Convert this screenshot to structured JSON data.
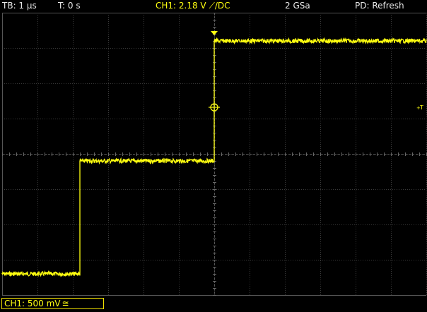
{
  "status_bar": {
    "timebase": "TB: 1 μs",
    "trigger_time": "T: 0 s",
    "channel_setting": "CH1: 2.18 V ⟋/DC",
    "sample_rate": "2 GSa",
    "display_mode": "PD: Refresh"
  },
  "channel_badge": {
    "label": "CH1: 500 mV",
    "coupling_symbol": "≅"
  },
  "trigger_label": "T",
  "colors": {
    "background": "#000000",
    "trace": "#ffff10",
    "grid": "#3a3a3a",
    "text": "#e8e8e8"
  },
  "waveform": {
    "timebase_per_div": "1 μs",
    "volts_per_div": "500 mV",
    "segments_us": [
      {
        "start": -6,
        "end": -3.8,
        "level_v": -1.7
      },
      {
        "start": -3.8,
        "end": 0,
        "level_v": -0.1
      },
      {
        "start": 0,
        "end": 6,
        "level_v": 1.6
      }
    ]
  }
}
